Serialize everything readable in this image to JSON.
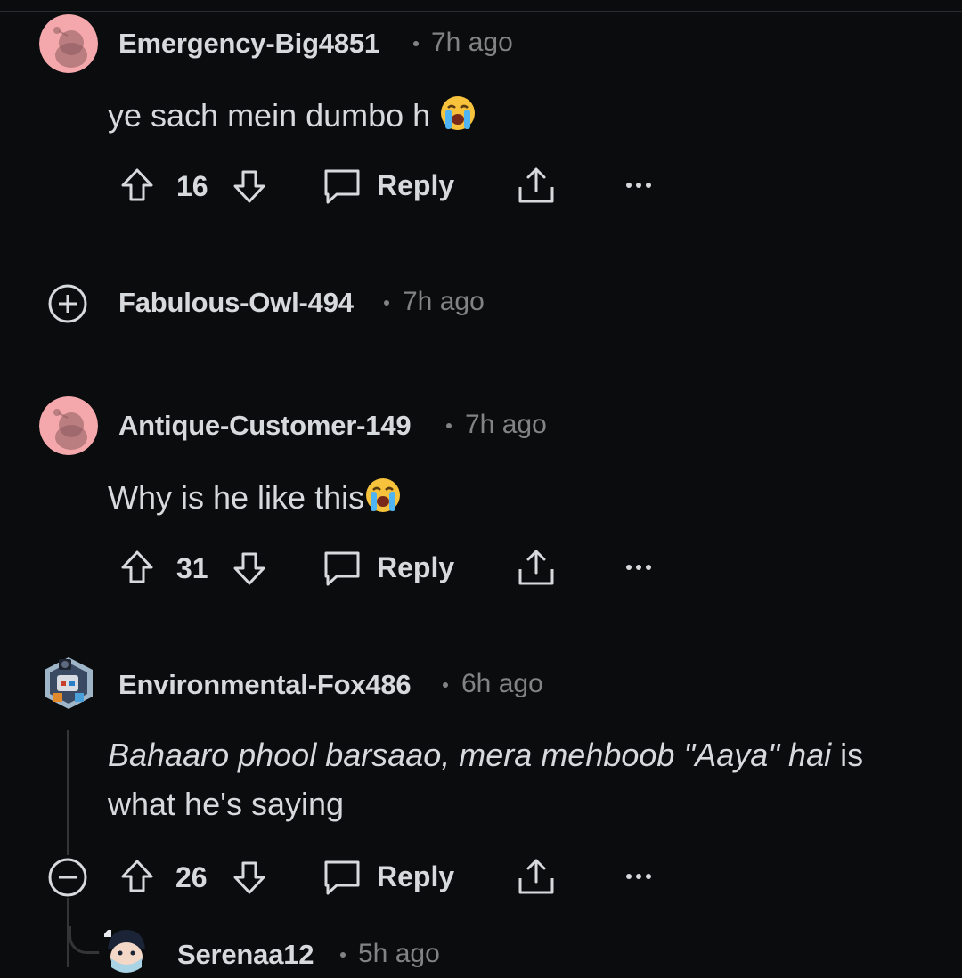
{
  "comments": [
    {
      "username": "Emergency-Big4851",
      "time": "7h ago",
      "text": "ye sach mein dumbo h",
      "votes": "16",
      "reply_label": "Reply",
      "avatar_icon": "snoo-avatar-icon",
      "emoji_icon": "loudly-crying-face-icon"
    },
    {
      "username": "Fabulous-Owl-494",
      "time": "7h ago",
      "collapsed": true,
      "expand_icon": "plus-circle-icon"
    },
    {
      "username": "Antique-Customer-149",
      "time": "7h ago",
      "text": "Why is he like this",
      "votes": "31",
      "reply_label": "Reply",
      "avatar_icon": "snoo-avatar-icon",
      "emoji_icon": "loudly-crying-face-icon"
    },
    {
      "username": "Environmental-Fox486",
      "time": "6h ago",
      "text_italic": "Bahaaro phool barsaao, mera mehboob \"Aaya\" hai",
      "text_rest_line1": " is",
      "text_line2": "what he's saying",
      "votes": "26",
      "reply_label": "Reply",
      "avatar_icon": "custom-avatar-icon",
      "collapse_icon": "minus-circle-icon"
    },
    {
      "username": "Serenaa12",
      "time": "5h ago",
      "avatar_icon": "custom-avatar-icon"
    }
  ],
  "colors": {
    "background": "#0b0c0e",
    "text": "#d7dadc",
    "meta": "#818384",
    "snoo_bg": "#f4a8ac"
  }
}
